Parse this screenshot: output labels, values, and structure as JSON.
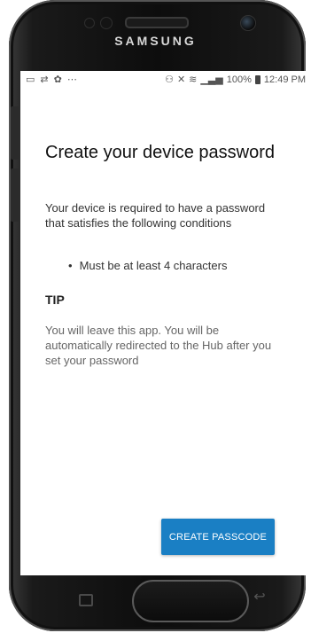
{
  "device": {
    "brand": "SAMSUNG"
  },
  "status_bar": {
    "left_icons": [
      "gallery-icon",
      "sync-icon",
      "settings-icon",
      "more-notifications-icon"
    ],
    "right_icons": [
      "nfc-icon",
      "mute-icon",
      "wifi-icon",
      "signal-icon",
      "battery-icon"
    ],
    "battery_percent": "100%",
    "time": "12:49 PM"
  },
  "page": {
    "title": "Create your device password",
    "description": "Your device is required to have a password that satisfies the following conditions",
    "conditions": [
      "Must be at least 4 characters"
    ],
    "tip_heading": "TIP",
    "tip_text": "You will leave this app. You will be automatically redirected to the Hub after you set your password",
    "primary_button_label": "CREATE PASSCODE"
  },
  "colors": {
    "accent": "#1a7fc4"
  }
}
